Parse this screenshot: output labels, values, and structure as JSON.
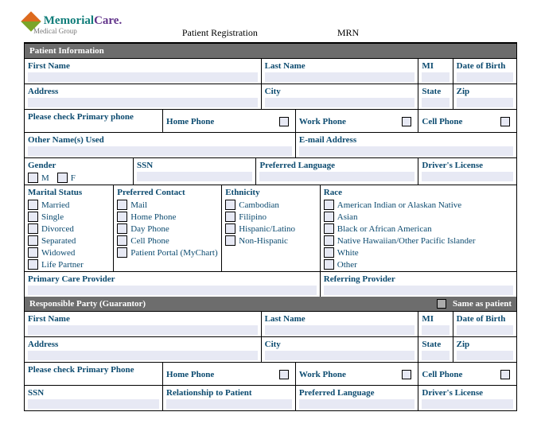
{
  "logo": {
    "brand1": "Memorial",
    "brand2": "Care",
    "sub": "Medical Group",
    "dot": "."
  },
  "header": {
    "title": "Patient Registration",
    "mrn": "MRN"
  },
  "sections": {
    "patient_info": "Patient Information",
    "responsible": "Responsible Party (Guarantor)",
    "same_as": "Same as patient"
  },
  "labels": {
    "first_name": "First Name",
    "last_name": "Last Name",
    "mi": "MI",
    "dob": "Date of Birth",
    "address": "Address",
    "city": "City",
    "state": "State",
    "zip": "Zip",
    "primary_phone": "Please check Primary phone",
    "primary_phone2": "Please check Primary Phone",
    "home_phone": "Home Phone",
    "work_phone": "Work Phone",
    "cell_phone": "Cell Phone",
    "other_names": "Other Name(s) Used",
    "email": "E-mail Address",
    "gender": "Gender",
    "m": "M",
    "f": "F",
    "ssn": "SSN",
    "pref_lang": "Preferred Language",
    "drivers": "Driver's License",
    "marital": "Marital Status",
    "pref_contact": "Preferred Contact",
    "ethnicity": "Ethnicity",
    "race": "Race",
    "pcp": "Primary Care Provider",
    "referring": "Referring Provider",
    "relationship": "Relationship to Patient"
  },
  "marital": [
    "Married",
    "Single",
    "Divorced",
    "Separated",
    "Widowed",
    "Life Partner"
  ],
  "contact": [
    "Mail",
    "Home Phone",
    "Day Phone",
    "Cell Phone",
    "Patient Portal (MyChart)"
  ],
  "ethnicity": [
    "Cambodian",
    "Filipino",
    "Hispanic/Latino",
    "Non-Hispanic"
  ],
  "race": [
    "American Indian or Alaskan Native",
    "Asian",
    "Black or African American",
    "Native Hawaiian/Other Pacific Islander",
    "White",
    "Other"
  ]
}
